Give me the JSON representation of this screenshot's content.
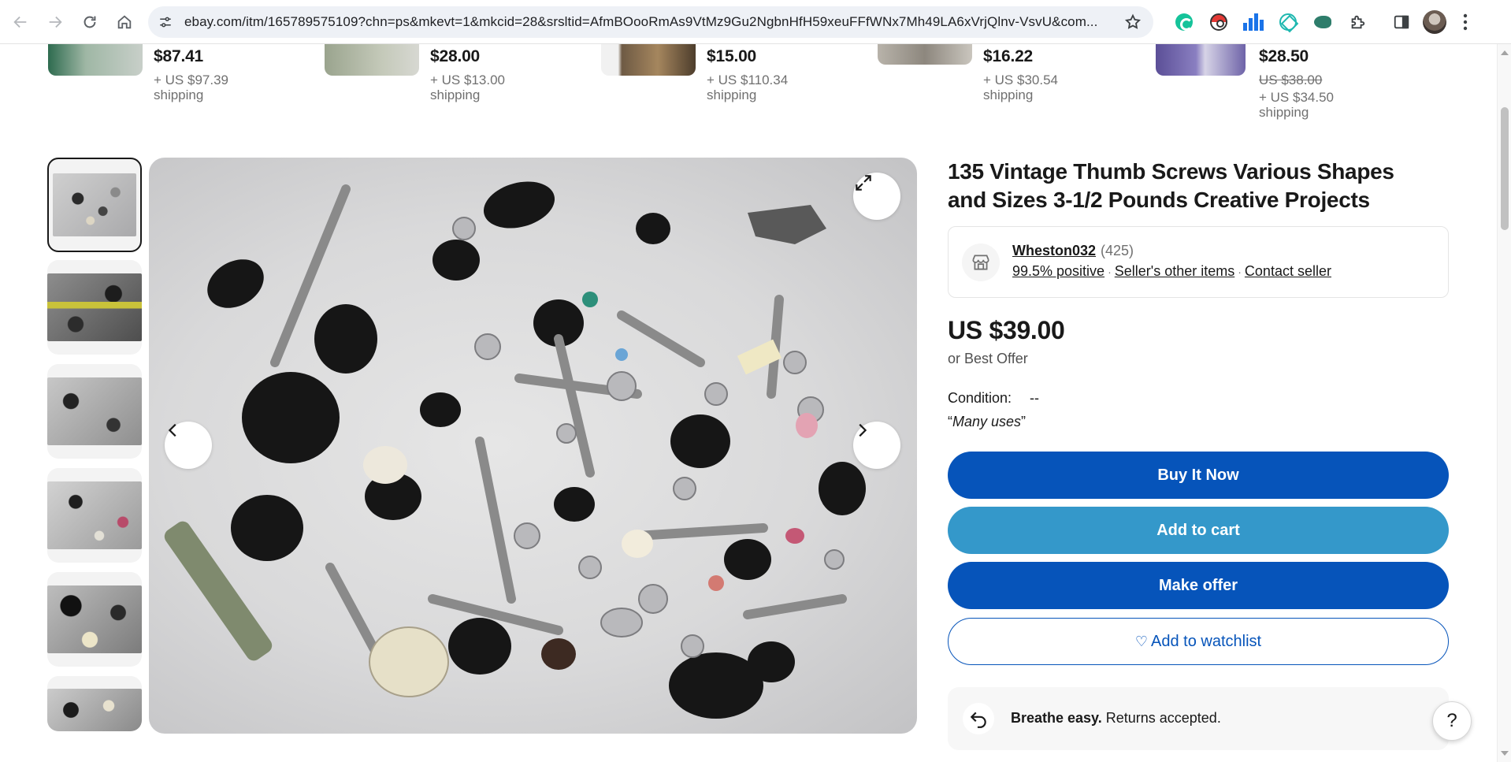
{
  "browser": {
    "url": "ebay.com/itm/165789575109?chn=ps&mkevt=1&mkcid=28&srsltid=AfmBOooRmAs9VtMz9Gu2NgbnHfH59xeuFFfWNx7Mh49LA6xVrjQlnv-VsvU&com...",
    "icons": [
      "back-icon",
      "forward-icon",
      "reload-icon",
      "home-icon",
      "site-info-icon",
      "star-icon",
      "grammarly-icon",
      "pokeball-icon",
      "bars-chart-icon",
      "teal-extension-icon",
      "fish-extension-icon",
      "puzzle-icon",
      "side-panel-icon",
      "avatar",
      "kebab-menu-icon"
    ]
  },
  "similar_items": [
    {
      "price": "$87.41",
      "original_price": "",
      "shipping": "+ US $97.39 shipping"
    },
    {
      "price": "$28.00",
      "original_price": "",
      "shipping": "+ US $13.00 shipping"
    },
    {
      "price": "$15.00",
      "original_price": "",
      "shipping": "+ US $110.34 shipping"
    },
    {
      "price": "$16.22",
      "original_price": "",
      "shipping": "+ US $30.54 shipping"
    },
    {
      "price": "$28.50",
      "original_price": "US $38.00",
      "shipping": "+ US $34.50 shipping"
    }
  ],
  "listing": {
    "title": "135 Vintage Thumb Screws Various Shapes and Sizes 3-1/2 Pounds Creative Projects",
    "seller": {
      "name": "Wheston032",
      "feedback_count": "(425)",
      "positive": "99.5% positive",
      "other_items": "Seller's other items",
      "contact": "Contact seller"
    },
    "price": "US $39.00",
    "best_offer": "or Best Offer",
    "condition_label": "Condition:",
    "condition_value": "--",
    "condition_quote_open": "“",
    "condition_quote_text": "Many uses",
    "condition_quote_close": "”",
    "buttons": {
      "buy_now": "Buy It Now",
      "add_to_cart": "Add to cart",
      "make_offer": "Make offer",
      "watchlist": "Add to watchlist",
      "watchlist_heart": "♡"
    },
    "returns": {
      "bold": "Breathe easy.",
      "text": " Returns accepted."
    }
  },
  "gallery": {
    "thumbnail_count": 6,
    "selected_index": 0
  },
  "help": {
    "label": "?"
  },
  "colors": {
    "primary_blue": "#0654ba",
    "cart_blue": "#3498ca",
    "text_dark": "#191919",
    "text_muted": "#707070"
  }
}
